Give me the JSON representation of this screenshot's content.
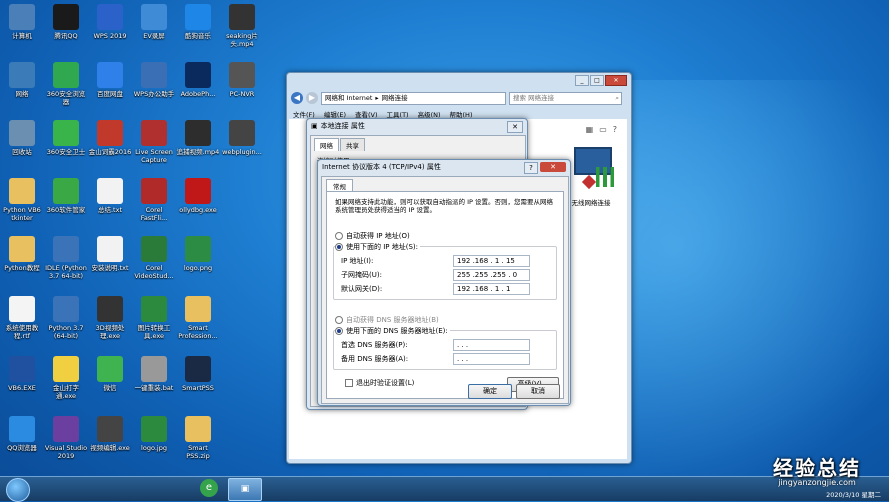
{
  "desktop": {
    "icons": [
      {
        "label": "计算机",
        "icon": "computer-icon",
        "color": "#4a7fb8"
      },
      {
        "label": "腾讯QQ",
        "icon": "qq-icon",
        "color": "#1a1a1a"
      },
      {
        "label": "WPS 2019",
        "icon": "wps-icon",
        "color": "#2a62c9"
      },
      {
        "label": "EV录屏",
        "icon": "ev-recorder-icon",
        "color": "#3f8bd6"
      },
      {
        "label": "酷狗音乐",
        "icon": "kugou-icon",
        "color": "#1e86e6"
      },
      {
        "label": "seaking片头.mp4",
        "icon": "video-file-icon",
        "color": "#333"
      },
      {
        "label": "网络",
        "icon": "network-icon",
        "color": "#3a7bb8"
      },
      {
        "label": "360安全浏览器",
        "icon": "360-browser-icon",
        "color": "#2fa84f"
      },
      {
        "label": "百度网盘",
        "icon": "baidu-netdisk-icon",
        "color": "#2f80e8"
      },
      {
        "label": "WPS办公助手",
        "icon": "wps-assistant-icon",
        "color": "#3a6fb5"
      },
      {
        "label": "AdobePh...",
        "icon": "photoshop-icon",
        "color": "#0a2a5e"
      },
      {
        "label": "PC-NVR",
        "icon": "nvr-icon",
        "color": "#555"
      },
      {
        "label": "回收站",
        "icon": "recycle-bin-icon",
        "color": "#6a8fb0"
      },
      {
        "label": "360安全卫士",
        "icon": "360-safe-icon",
        "color": "#39b44a"
      },
      {
        "label": "金山词霸2016",
        "icon": "jinshan-icon",
        "color": "#c0392b"
      },
      {
        "label": "Live Screen Capture",
        "icon": "screen-capture-icon",
        "color": "#b03030"
      },
      {
        "label": "追捕视频.mp4",
        "icon": "video-file-icon",
        "color": "#2d2d2d"
      },
      {
        "label": "webplugin...",
        "icon": "webplugin-icon",
        "color": "#444"
      },
      {
        "label": "Python VB6 tkinter",
        "icon": "folder-icon",
        "color": "#e8c060"
      },
      {
        "label": "360软件管家",
        "icon": "360-software-icon",
        "color": "#3aa845"
      },
      {
        "label": "总结.txt",
        "icon": "text-file-icon",
        "color": "#f2f2f2"
      },
      {
        "label": "Corel FastFli...",
        "icon": "corel-icon",
        "color": "#b02a2a"
      },
      {
        "label": "ollydbg.exe",
        "icon": "ollydbg-icon",
        "color": "#c01818"
      },
      {
        "label": "Python教程",
        "icon": "folder-icon",
        "color": "#e8c060"
      },
      {
        "label": "IDLE (Python 3.7 64-bit)",
        "icon": "python-idle-icon",
        "color": "#3b73b9"
      },
      {
        "label": "安装说明.txt",
        "icon": "text-file-icon",
        "color": "#f2f2f2"
      },
      {
        "label": "Corel VideoStud...",
        "icon": "corel-video-icon",
        "color": "#2a7a3a"
      },
      {
        "label": "logo.png",
        "icon": "image-file-icon",
        "color": "#2c8c44"
      },
      {
        "label": "系统使用教程.rtf",
        "icon": "rtf-file-icon",
        "color": "#f4f4f4"
      },
      {
        "label": "Python 3.7 (64-bit)",
        "icon": "python-icon",
        "color": "#3b73b9"
      },
      {
        "label": "3D视频处理.exe",
        "icon": "3d-video-icon",
        "color": "#333"
      },
      {
        "label": "图片转换工具.exe",
        "icon": "converter-icon",
        "color": "#2b8a3e"
      },
      {
        "label": "Smart Profession...",
        "icon": "folder-icon",
        "color": "#e8c060"
      },
      {
        "label": "VB6.EXE",
        "icon": "vb6-icon",
        "color": "#2050a0"
      },
      {
        "label": "金山打字通.exe",
        "icon": "jinshan-typing-icon",
        "color": "#f0d040"
      },
      {
        "label": "微信",
        "icon": "wechat-icon",
        "color": "#3fb34f"
      },
      {
        "label": "一键重装.bat",
        "icon": "bat-file-icon",
        "color": "#999"
      },
      {
        "label": "SmartPSS",
        "icon": "smartpss-icon",
        "color": "#1b2a44"
      },
      {
        "label": "QQ浏览器",
        "icon": "qq-browser-icon",
        "color": "#2a8be0"
      },
      {
        "label": "Visual Studio 2019",
        "icon": "visual-studio-icon",
        "color": "#6b3fa0"
      },
      {
        "label": "视频编辑.exe",
        "icon": "video-editor-icon",
        "color": "#444"
      },
      {
        "label": "logo.jpg",
        "icon": "image-file-icon",
        "color": "#2b8a3e"
      },
      {
        "label": "Smart PSS.zip",
        "icon": "zip-file-icon",
        "color": "#e8c060"
      }
    ]
  },
  "explorer": {
    "breadcrumb": [
      "网络和 Internet",
      "网络连接"
    ],
    "search_placeholder": "搜索 网络连接",
    "menu": [
      "文件(F)",
      "编辑(E)",
      "查看(V)",
      "工具(T)",
      "高级(N)",
      "帮助(H)"
    ],
    "adapter_label": "无线网络连接"
  },
  "local_props": {
    "title": "本地连接 属性",
    "tabs": [
      "网络",
      "共享"
    ],
    "partial_text": "连接时使用:"
  },
  "tcpip": {
    "title": "Internet 协议版本 4 (TCP/IPv4) 属性",
    "tab": "常规",
    "description": "如果网络支持此功能，则可以获取自动指派的 IP 设置。否则，您需要从网络系统管理员处获得适当的 IP 设置。",
    "auto_ip": "自动获得 IP 地址(O)",
    "manual_ip": "使用下面的 IP 地址(S):",
    "ip_label": "IP 地址(I):",
    "ip_value": "192 .168 . 1  . 15",
    "mask_label": "子网掩码(U):",
    "mask_value": "255 .255 .255 . 0",
    "gateway_label": "默认网关(D):",
    "gateway_value": "192 .168 . 1  . 1",
    "auto_dns": "自动获得 DNS 服务器地址(B)",
    "manual_dns": "使用下面的 DNS 服务器地址(E):",
    "dns1_label": "首选 DNS 服务器(P):",
    "dns1_value": " .   .   .",
    "dns2_label": "备用 DNS 服务器(A):",
    "dns2_value": " .   .   .",
    "validate": "退出时验证设置(L)",
    "advanced": "高级(V)...",
    "ok": "确定",
    "cancel": "取消"
  },
  "taskbar": {
    "clock_date": "2020/3/10 星期二"
  },
  "watermark": {
    "title": "经验总结",
    "url": "jingyanzongjie.com"
  }
}
